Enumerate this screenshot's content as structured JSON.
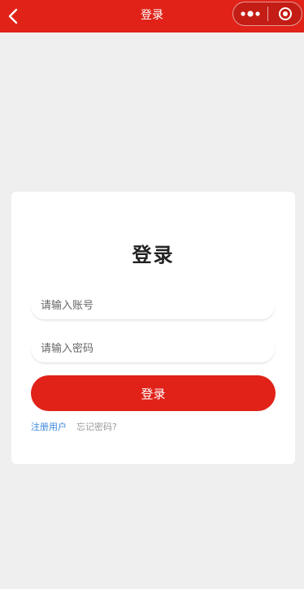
{
  "header": {
    "title": "登录",
    "back_icon": "chevron-left-icon",
    "more_icon": "more-dots-icon",
    "close_icon": "target-close-icon",
    "bg_color": "#e02219"
  },
  "login_card": {
    "title": "登录",
    "account_placeholder": "请输入账号",
    "password_placeholder": "请输入密码",
    "submit_label": "登录",
    "register_link": "注册用户",
    "forgot_link": "忘记密码?",
    "accent_color": "#e02219",
    "link_color": "#3a86d8"
  }
}
